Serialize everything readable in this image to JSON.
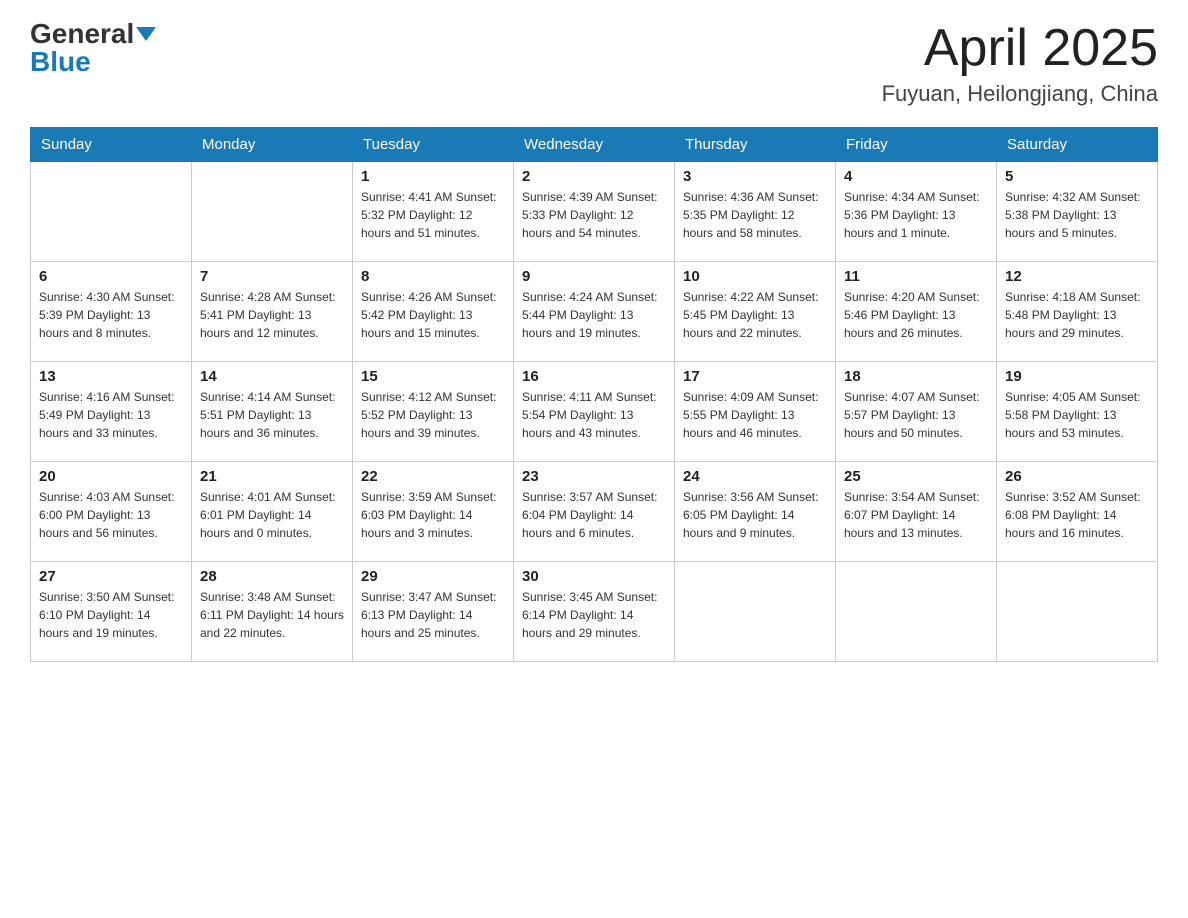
{
  "header": {
    "logo_general": "General",
    "logo_blue": "Blue",
    "month_title": "April 2025",
    "location": "Fuyuan, Heilongjiang, China"
  },
  "calendar": {
    "days_of_week": [
      "Sunday",
      "Monday",
      "Tuesday",
      "Wednesday",
      "Thursday",
      "Friday",
      "Saturday"
    ],
    "weeks": [
      [
        {
          "day": "",
          "info": ""
        },
        {
          "day": "",
          "info": ""
        },
        {
          "day": "1",
          "info": "Sunrise: 4:41 AM\nSunset: 5:32 PM\nDaylight: 12 hours\nand 51 minutes."
        },
        {
          "day": "2",
          "info": "Sunrise: 4:39 AM\nSunset: 5:33 PM\nDaylight: 12 hours\nand 54 minutes."
        },
        {
          "day": "3",
          "info": "Sunrise: 4:36 AM\nSunset: 5:35 PM\nDaylight: 12 hours\nand 58 minutes."
        },
        {
          "day": "4",
          "info": "Sunrise: 4:34 AM\nSunset: 5:36 PM\nDaylight: 13 hours\nand 1 minute."
        },
        {
          "day": "5",
          "info": "Sunrise: 4:32 AM\nSunset: 5:38 PM\nDaylight: 13 hours\nand 5 minutes."
        }
      ],
      [
        {
          "day": "6",
          "info": "Sunrise: 4:30 AM\nSunset: 5:39 PM\nDaylight: 13 hours\nand 8 minutes."
        },
        {
          "day": "7",
          "info": "Sunrise: 4:28 AM\nSunset: 5:41 PM\nDaylight: 13 hours\nand 12 minutes."
        },
        {
          "day": "8",
          "info": "Sunrise: 4:26 AM\nSunset: 5:42 PM\nDaylight: 13 hours\nand 15 minutes."
        },
        {
          "day": "9",
          "info": "Sunrise: 4:24 AM\nSunset: 5:44 PM\nDaylight: 13 hours\nand 19 minutes."
        },
        {
          "day": "10",
          "info": "Sunrise: 4:22 AM\nSunset: 5:45 PM\nDaylight: 13 hours\nand 22 minutes."
        },
        {
          "day": "11",
          "info": "Sunrise: 4:20 AM\nSunset: 5:46 PM\nDaylight: 13 hours\nand 26 minutes."
        },
        {
          "day": "12",
          "info": "Sunrise: 4:18 AM\nSunset: 5:48 PM\nDaylight: 13 hours\nand 29 minutes."
        }
      ],
      [
        {
          "day": "13",
          "info": "Sunrise: 4:16 AM\nSunset: 5:49 PM\nDaylight: 13 hours\nand 33 minutes."
        },
        {
          "day": "14",
          "info": "Sunrise: 4:14 AM\nSunset: 5:51 PM\nDaylight: 13 hours\nand 36 minutes."
        },
        {
          "day": "15",
          "info": "Sunrise: 4:12 AM\nSunset: 5:52 PM\nDaylight: 13 hours\nand 39 minutes."
        },
        {
          "day": "16",
          "info": "Sunrise: 4:11 AM\nSunset: 5:54 PM\nDaylight: 13 hours\nand 43 minutes."
        },
        {
          "day": "17",
          "info": "Sunrise: 4:09 AM\nSunset: 5:55 PM\nDaylight: 13 hours\nand 46 minutes."
        },
        {
          "day": "18",
          "info": "Sunrise: 4:07 AM\nSunset: 5:57 PM\nDaylight: 13 hours\nand 50 minutes."
        },
        {
          "day": "19",
          "info": "Sunrise: 4:05 AM\nSunset: 5:58 PM\nDaylight: 13 hours\nand 53 minutes."
        }
      ],
      [
        {
          "day": "20",
          "info": "Sunrise: 4:03 AM\nSunset: 6:00 PM\nDaylight: 13 hours\nand 56 minutes."
        },
        {
          "day": "21",
          "info": "Sunrise: 4:01 AM\nSunset: 6:01 PM\nDaylight: 14 hours\nand 0 minutes."
        },
        {
          "day": "22",
          "info": "Sunrise: 3:59 AM\nSunset: 6:03 PM\nDaylight: 14 hours\nand 3 minutes."
        },
        {
          "day": "23",
          "info": "Sunrise: 3:57 AM\nSunset: 6:04 PM\nDaylight: 14 hours\nand 6 minutes."
        },
        {
          "day": "24",
          "info": "Sunrise: 3:56 AM\nSunset: 6:05 PM\nDaylight: 14 hours\nand 9 minutes."
        },
        {
          "day": "25",
          "info": "Sunrise: 3:54 AM\nSunset: 6:07 PM\nDaylight: 14 hours\nand 13 minutes."
        },
        {
          "day": "26",
          "info": "Sunrise: 3:52 AM\nSunset: 6:08 PM\nDaylight: 14 hours\nand 16 minutes."
        }
      ],
      [
        {
          "day": "27",
          "info": "Sunrise: 3:50 AM\nSunset: 6:10 PM\nDaylight: 14 hours\nand 19 minutes."
        },
        {
          "day": "28",
          "info": "Sunrise: 3:48 AM\nSunset: 6:11 PM\nDaylight: 14 hours\nand 22 minutes."
        },
        {
          "day": "29",
          "info": "Sunrise: 3:47 AM\nSunset: 6:13 PM\nDaylight: 14 hours\nand 25 minutes."
        },
        {
          "day": "30",
          "info": "Sunrise: 3:45 AM\nSunset: 6:14 PM\nDaylight: 14 hours\nand 29 minutes."
        },
        {
          "day": "",
          "info": ""
        },
        {
          "day": "",
          "info": ""
        },
        {
          "day": "",
          "info": ""
        }
      ]
    ]
  }
}
